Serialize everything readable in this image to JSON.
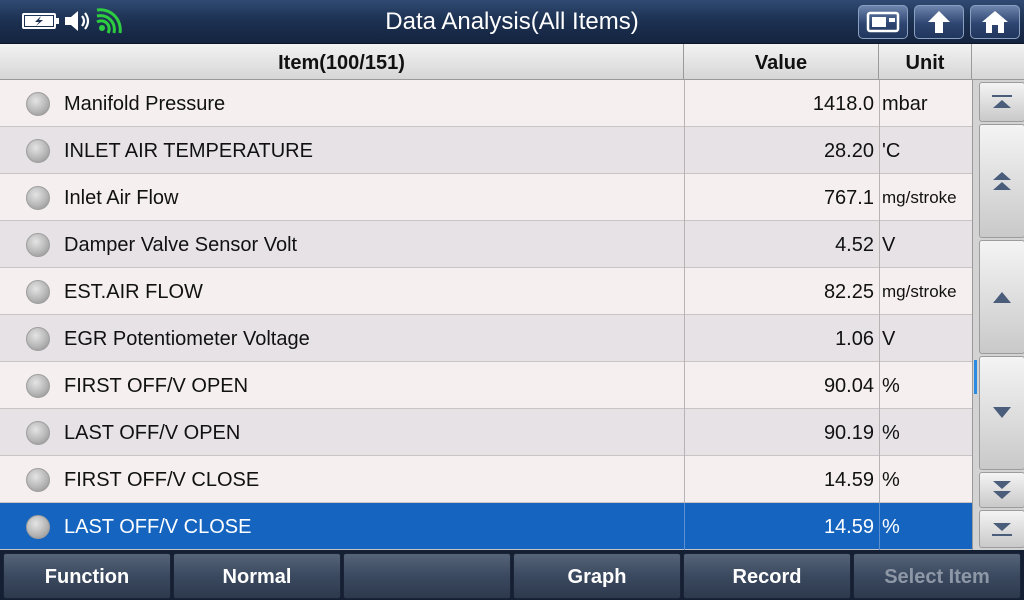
{
  "window": {
    "title": "Data Analysis(All Items)"
  },
  "status_icons": [
    "battery-charging-icon",
    "speaker-icon",
    "wifi-icon"
  ],
  "toolbar": {
    "buttons": [
      "screenshot-icon",
      "back-arrow-icon",
      "home-icon"
    ]
  },
  "table": {
    "headers": {
      "item": "Item(100/151)",
      "value": "Value",
      "unit": "Unit"
    },
    "rows": [
      {
        "name": "Manifold Pressure",
        "value": "1418.0",
        "unit": "mbar"
      },
      {
        "name": "INLET AIR TEMPERATURE",
        "value": "28.20",
        "unit": "'C"
      },
      {
        "name": "Inlet Air Flow",
        "value": "767.1",
        "unit": "mg/stroke"
      },
      {
        "name": "Damper Valve Sensor Volt",
        "value": "4.52",
        "unit": "V"
      },
      {
        "name": "EST.AIR FLOW",
        "value": "82.25",
        "unit": "mg/stroke"
      },
      {
        "name": "EGR Potentiometer Voltage",
        "value": "1.06",
        "unit": "V"
      },
      {
        "name": "FIRST OFF/V OPEN",
        "value": "90.04",
        "unit": "%"
      },
      {
        "name": "LAST OFF/V OPEN",
        "value": "90.19",
        "unit": "%"
      },
      {
        "name": "FIRST OFF/V CLOSE",
        "value": "14.59",
        "unit": "%"
      },
      {
        "name": "LAST OFF/V CLOSE",
        "value": "14.59",
        "unit": "%"
      }
    ],
    "selected_index": 9,
    "selected_color": "#1565c0"
  },
  "scroll": {
    "buttons": [
      "scroll-top-icon",
      "page-up-icon",
      "line-up-icon",
      "line-down-icon",
      "page-down-icon",
      "scroll-bottom-icon"
    ]
  },
  "bottom": {
    "function": "Function",
    "normal": "Normal",
    "blank": "",
    "graph": "Graph",
    "record": "Record",
    "select_item": "Select Item"
  }
}
